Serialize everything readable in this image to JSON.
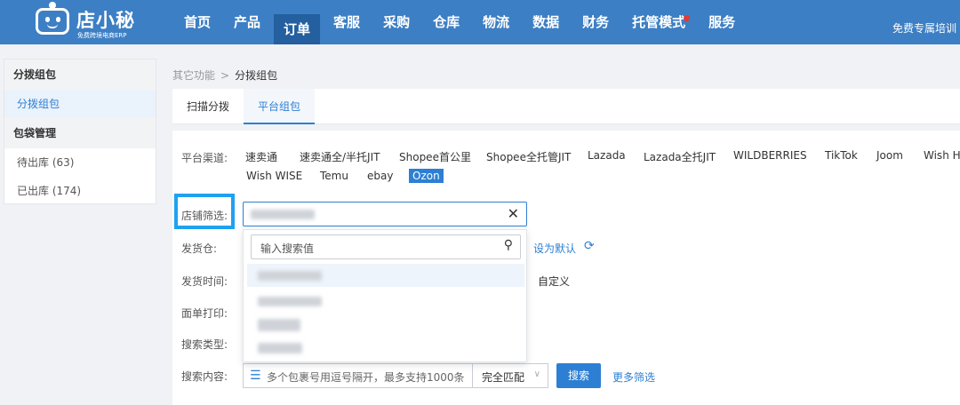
{
  "brand": {
    "title": "店小秘",
    "subtitle": "免费跨境电商ERP"
  },
  "nav": {
    "items": [
      {
        "label": "首页"
      },
      {
        "label": "产品"
      },
      {
        "label": "订单"
      },
      {
        "label": "客服"
      },
      {
        "label": "采购"
      },
      {
        "label": "仓库"
      },
      {
        "label": "物流"
      },
      {
        "label": "数据"
      },
      {
        "label": "财务"
      },
      {
        "label": "托管模式"
      },
      {
        "label": "服务"
      }
    ],
    "active": "订单",
    "right_link": "免费专属培训"
  },
  "sidebar": {
    "groups": [
      {
        "title": "分拨组包",
        "items": [
          {
            "label": "分拨组包",
            "active": true
          }
        ]
      },
      {
        "title": "包袋管理",
        "items": [
          {
            "label": "待出库 (63)"
          },
          {
            "label": "已出库 (174)"
          }
        ]
      }
    ]
  },
  "breadcrumb": {
    "parent": "其它功能",
    "sep": ">",
    "current": "分拨组包"
  },
  "tabs": [
    {
      "label": "扫描分拨"
    },
    {
      "label": "平台组包",
      "active": true
    }
  ],
  "filters": {
    "channel_label": "平台渠道:",
    "channels": [
      "速卖通",
      "速卖通全/半托JIT",
      "Shopee首公里",
      "Shopee全托管JIT",
      "Lazada",
      "Lazada全托JIT",
      "WILDBERRIES",
      "TikTok",
      "Joom",
      "Wish HU",
      "Wish WISE",
      "Temu",
      "ebay",
      "Ozon"
    ],
    "active_channel": "Ozon",
    "shop_label": "店铺筛选:",
    "shop_clear": "✕",
    "dropdown_placeholder": "输入搜索值",
    "warehouse_label": "发货仓:",
    "set_default": "设为默认",
    "time_label": "发货时间:",
    "custom": "自定义",
    "print_label": "面单打印:",
    "search_type_label": "搜索类型:",
    "search_content_label": "搜索内容:",
    "search_placeholder": "多个包裹号用逗号隔开，最多支持1000条",
    "match_value": "完全匹配",
    "search_button": "搜索",
    "more_filters": "更多筛选"
  },
  "colors": {
    "nav_bg": "#3d7fc4",
    "accent": "#2d7fd3",
    "highlight_border": "#1fa1f0"
  }
}
